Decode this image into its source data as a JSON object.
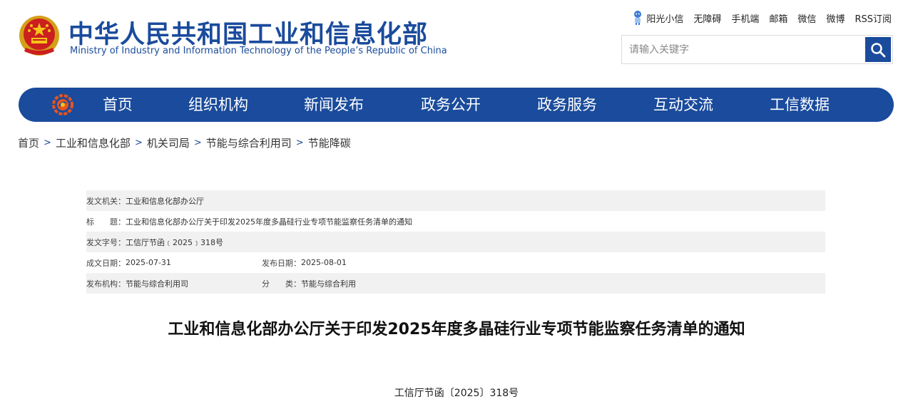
{
  "header": {
    "title": "中华人民共和国工业和信息化部",
    "subtitle": "Ministry of Industry and Information Technology of the People’s Republic of China",
    "emblem_icon": "national-emblem-icon",
    "top_links": [
      "阳光小信",
      "无障碍",
      "手机端",
      "邮箱",
      "微信",
      "微博",
      "RSS订阅"
    ],
    "search": {
      "placeholder": "请输入关键字",
      "icon": "search-icon"
    }
  },
  "nav": {
    "items": [
      "首页",
      "组织机构",
      "新闻发布",
      "政务公开",
      "政务服务",
      "互动交流",
      "工信数据"
    ],
    "color": "#1a4b9c"
  },
  "breadcrumb": {
    "items": [
      "首页",
      "工业和信息化部",
      "机关司局",
      "节能与综合利用司",
      "节能降碳"
    ],
    "separator": ">"
  },
  "info": {
    "issuer_label": "发文机关：",
    "issuer": "工业和信息化部办公厅",
    "title_label": "标　　题：",
    "title": "工业和信息化部办公厅关于印发2025年度多晶硅行业专项节能监察任务清单的通知",
    "docno_label": "发文字号：",
    "docno": "工信厅节函﹝2025﹞318号",
    "created_label": "成文日期：",
    "created": "2025-07-31",
    "published_label": "发布日期：",
    "published": "2025-08-01",
    "org_label": "发布机构：",
    "org": "节能与综合利用司",
    "category_label": "分　　类：",
    "category": "节能与综合利用"
  },
  "article": {
    "title": "工业和信息化部办公厅关于印发2025年度多晶硅行业专项节能监察任务清单的通知",
    "doc_number": "工信厅节函〔2025〕318号"
  }
}
